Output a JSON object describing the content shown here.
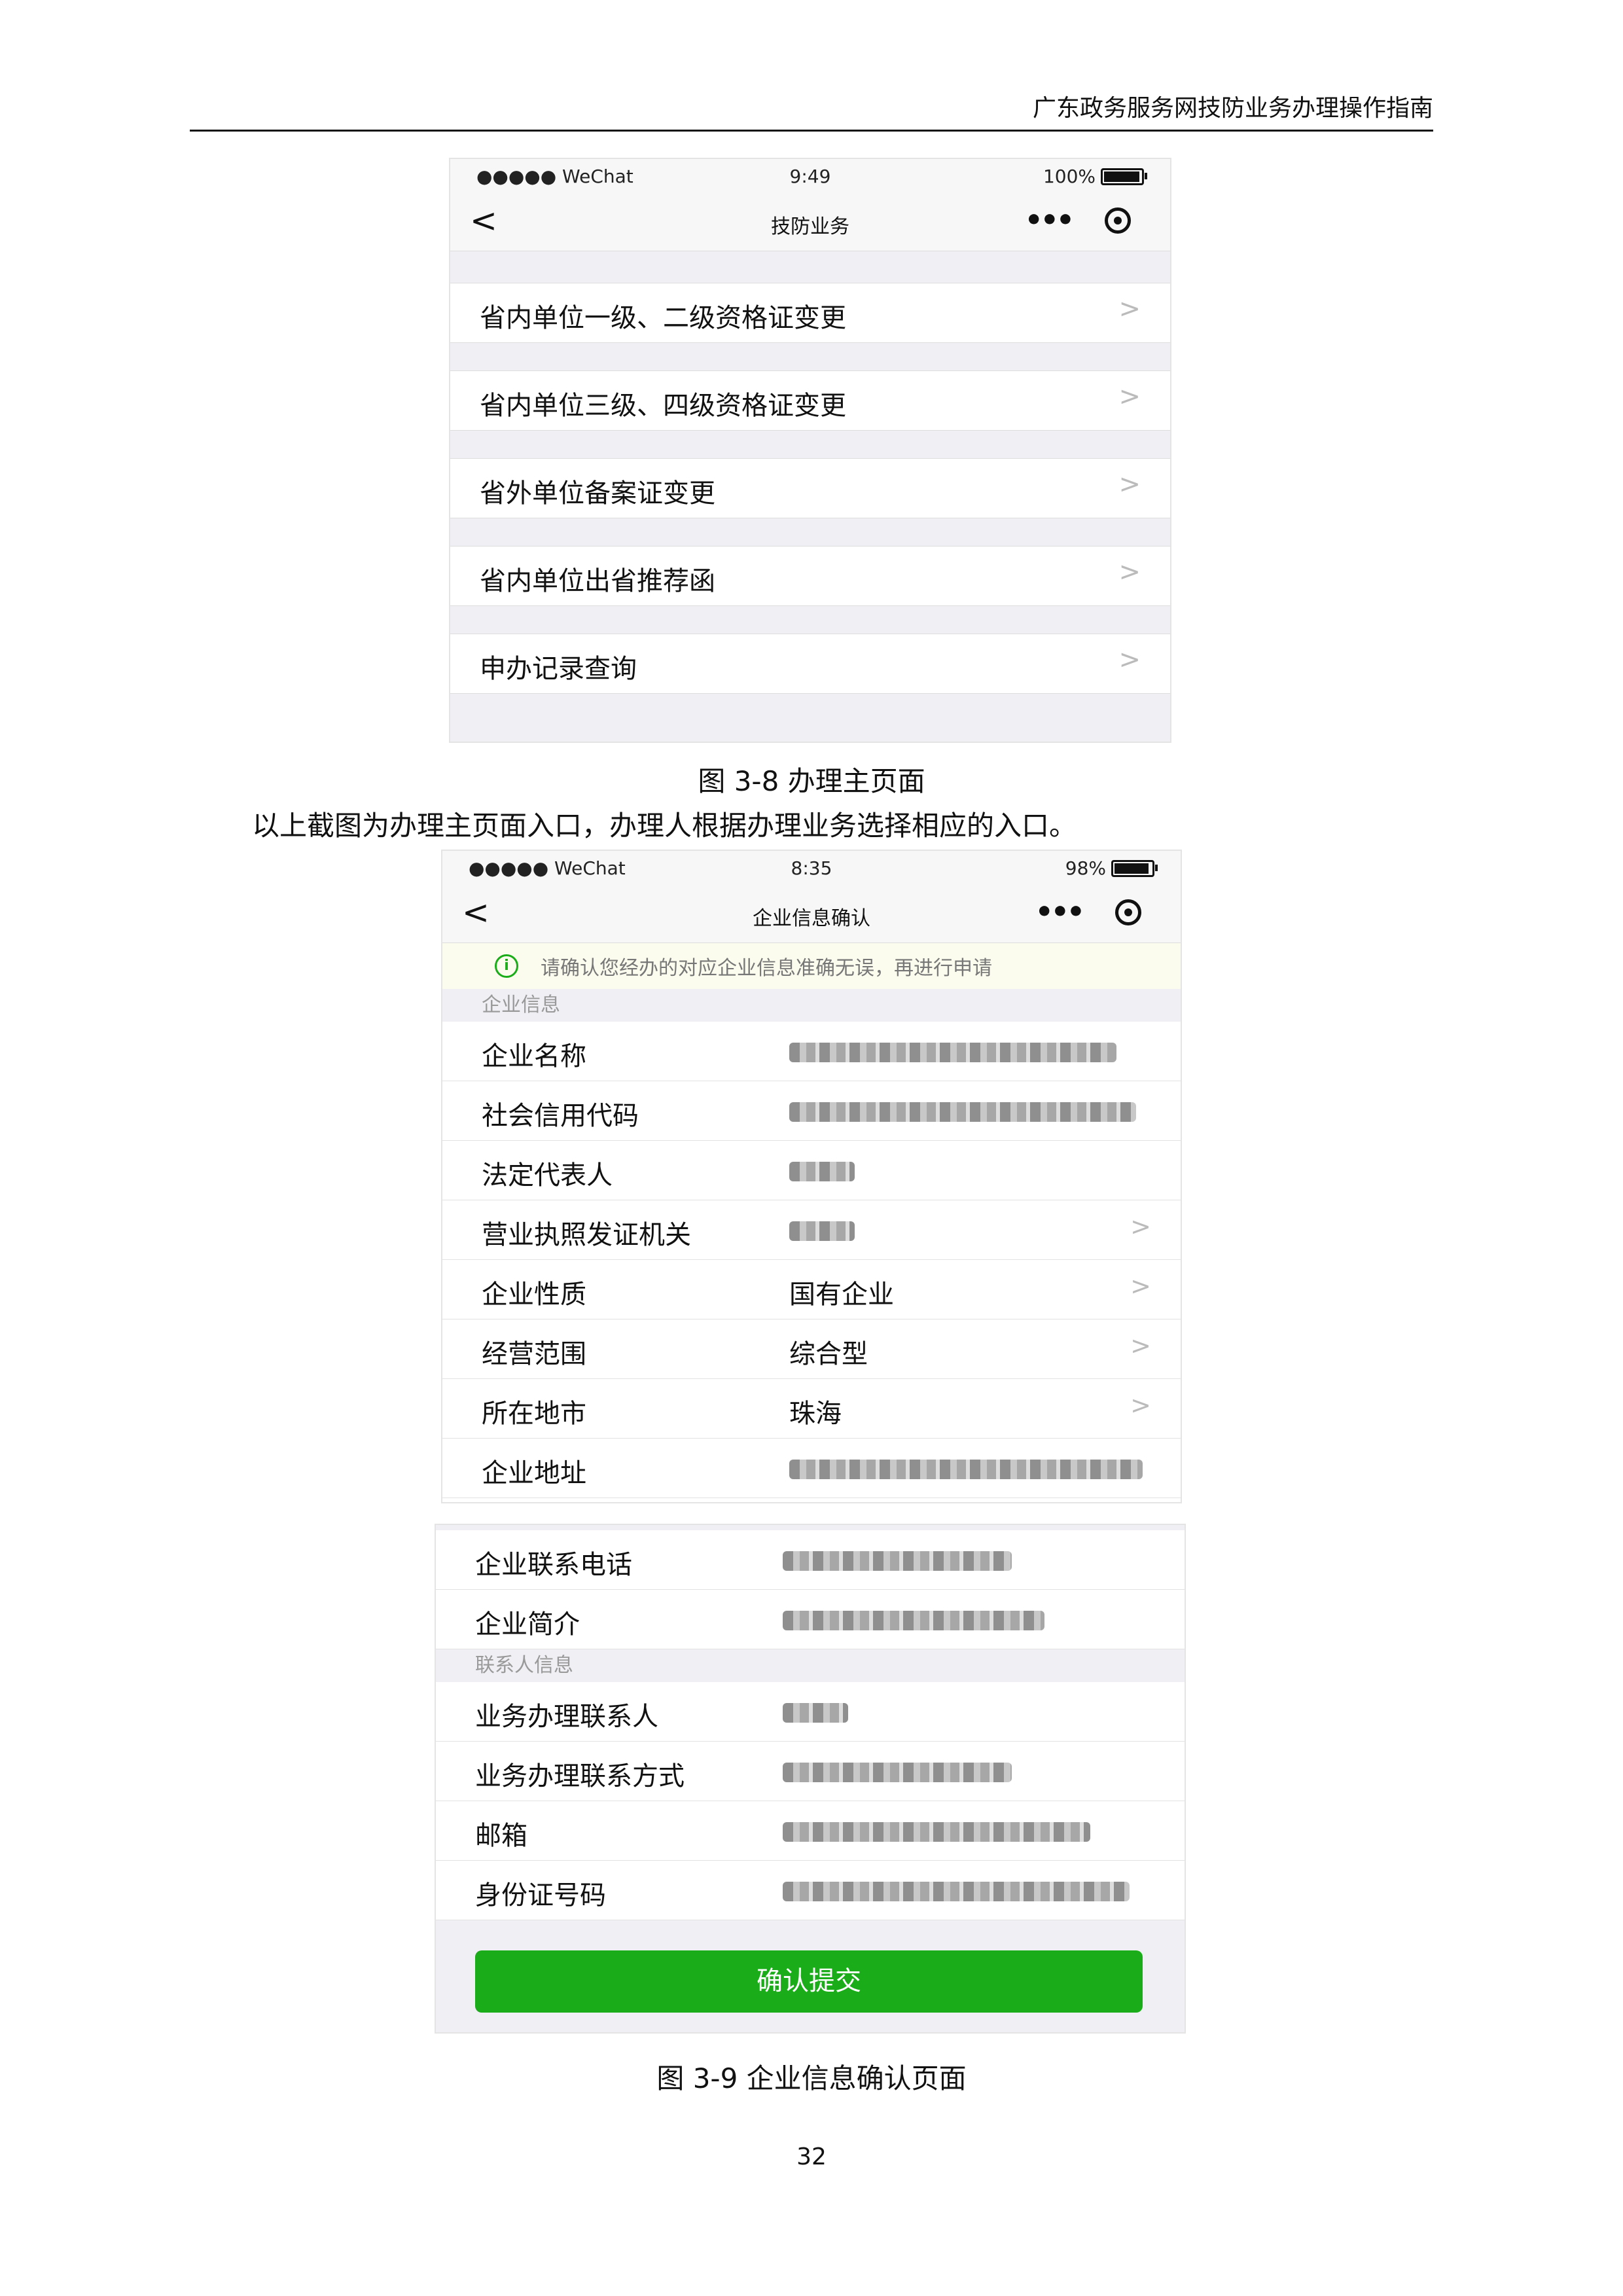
{
  "header": {
    "title": "广东政务服务网技防业务办理操作指南"
  },
  "phone1": {
    "status": {
      "carrier": "●●●●● WeChat",
      "time": "9:49",
      "battery": "100%"
    },
    "nav": {
      "back": "<",
      "title": "技防业务",
      "more": "•••"
    },
    "menu": [
      {
        "label": "省内单位一级、二级资格证变更"
      },
      {
        "label": "省内单位三级、四级资格证变更"
      },
      {
        "label": "省外单位备案证变更"
      },
      {
        "label": "省内单位出省推荐函"
      },
      {
        "label": "申办记录查询"
      }
    ],
    "chevron": ">"
  },
  "caption1": "图 3-8 办理主页面",
  "paragraph": "以上截图为办理主页面入口，办理人根据办理业务选择相应的入口。",
  "phone2": {
    "status": {
      "carrier": "●●●●● WeChat",
      "time": "8:35",
      "battery": "98%"
    },
    "nav": {
      "back": "<",
      "title": "企业信息确认",
      "more": "•••"
    },
    "notice": {
      "icon": "i",
      "text": "请确认您经办的对应企业信息准确无误，再进行申请"
    },
    "section_company": "企业信息",
    "rows_company": [
      {
        "key": "企业名称",
        "value": ""
      },
      {
        "key": "社会信用代码",
        "value": ""
      },
      {
        "key": "法定代表人",
        "value": ""
      },
      {
        "key": "营业执照发证机关",
        "value": ""
      },
      {
        "key": "企业性质",
        "value": "国有企业"
      },
      {
        "key": "经营范围",
        "value": "综合型"
      },
      {
        "key": "所在地市",
        "value": "珠海"
      },
      {
        "key": "企业地址",
        "value": ""
      }
    ]
  },
  "phone3": {
    "rows_top": [
      {
        "key": "企业联系电话",
        "value": ""
      },
      {
        "key": "企业简介",
        "value": ""
      }
    ],
    "section_contact": "联系人信息",
    "rows_contact": [
      {
        "key": "业务办理联系人",
        "value": ""
      },
      {
        "key": "业务办理联系方式",
        "value": ""
      },
      {
        "key": "邮箱",
        "value": ""
      },
      {
        "key": "身份证号码",
        "value": ""
      }
    ],
    "submit": "确认提交"
  },
  "caption2": "图 3-9 企业信息确认页面",
  "page_number": "32",
  "colors": {
    "wechat_green": "#1aad19",
    "background_gray": "#efeff4"
  }
}
